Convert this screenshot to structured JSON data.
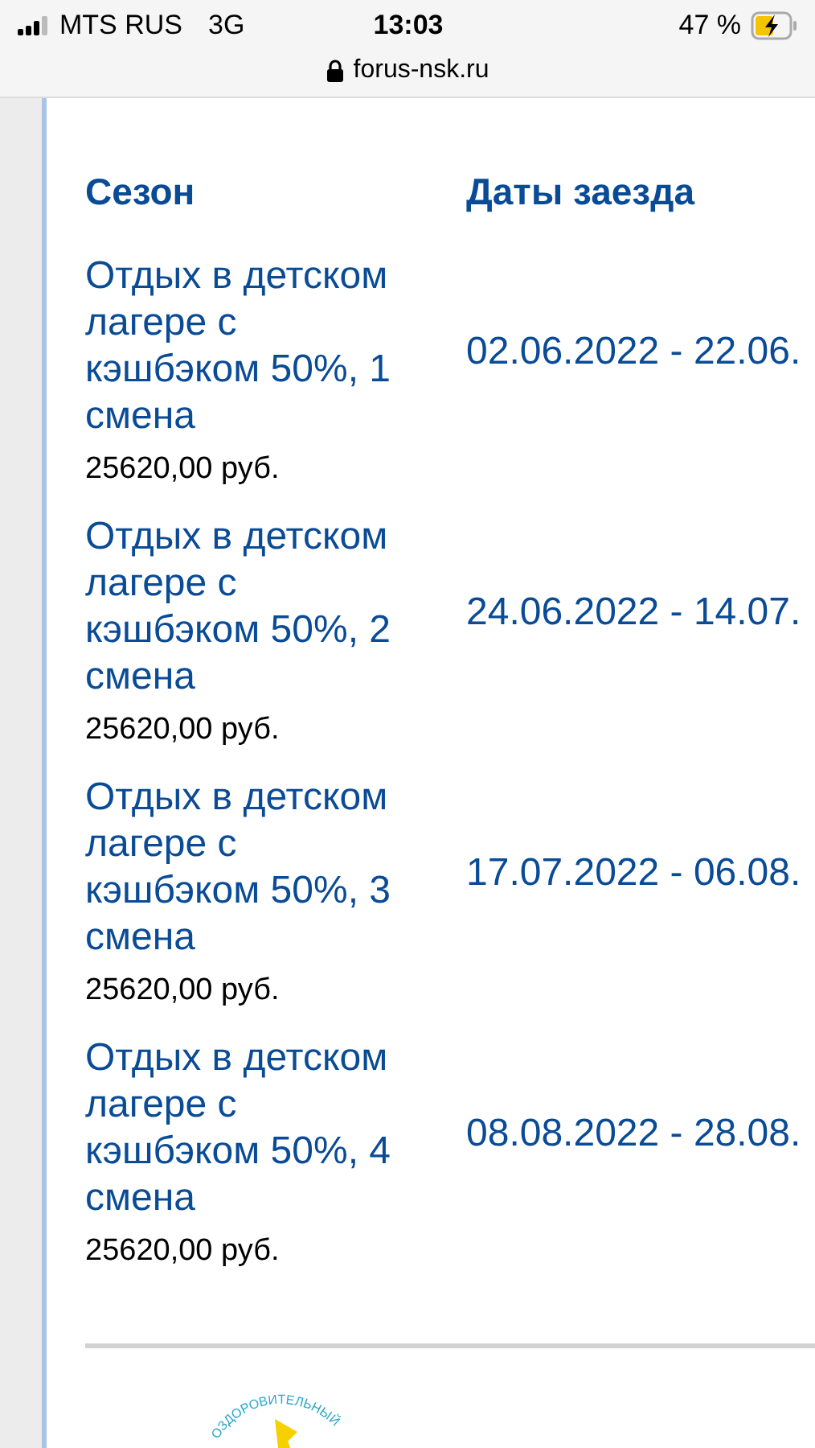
{
  "status_bar": {
    "carrier": "MTS RUS",
    "network": "3G",
    "time": "13:03",
    "battery": "47 %",
    "charging": true
  },
  "address_bar": {
    "url": "forus-nsk.ru",
    "secure": true
  },
  "table": {
    "columns": [
      "Сезон",
      "Даты заезда"
    ],
    "rows": [
      {
        "season": "Отдых в детском лагере с кэшбэком 50%, 1 смена",
        "price": "25620,00 руб.",
        "dates": "02.06.2022 - 22.06."
      },
      {
        "season": "Отдых в детском лагере с кэшбэком 50%, 2 смена",
        "price": "25620,00 руб.",
        "dates": "24.06.2022 - 14.07."
      },
      {
        "season": "Отдых в детском лагере с кэшбэком 50%, 3 смена",
        "price": "25620,00 руб.",
        "dates": "17.07.2022 - 06.08."
      },
      {
        "season": "Отдых в детском лагере с кэшбэком 50%, 4 смена",
        "price": "25620,00 руб.",
        "dates": "08.08.2022 - 28.08."
      }
    ]
  },
  "footer": {
    "logo_text": "ОЗДОРОВИТЕЛЬНЫЙ"
  }
}
